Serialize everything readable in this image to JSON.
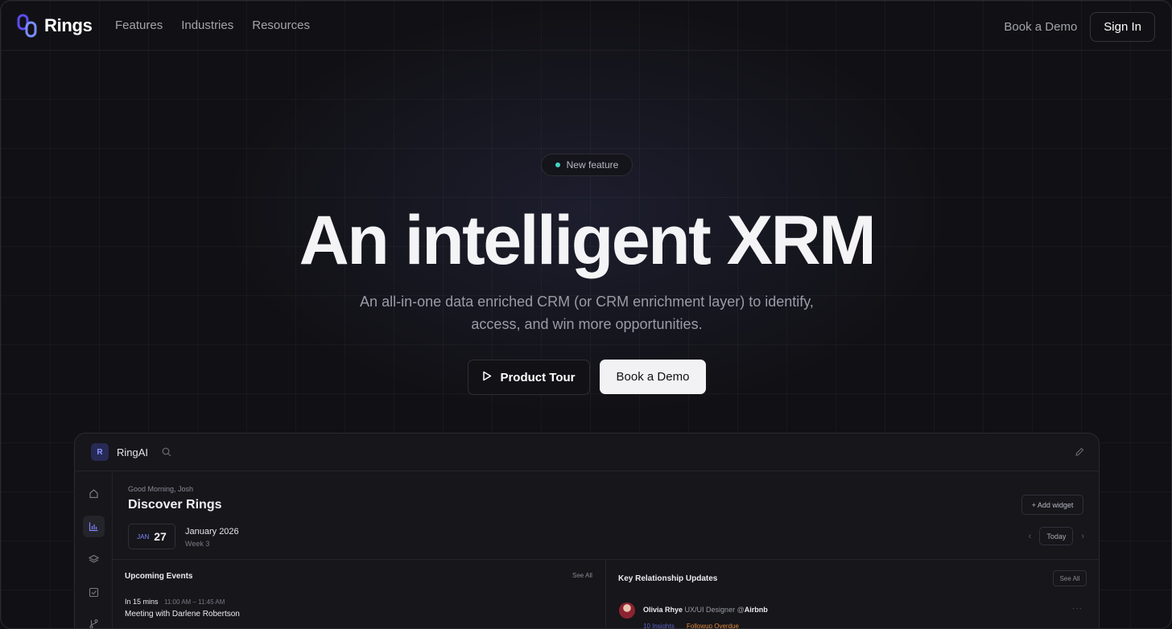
{
  "nav": {
    "brand": "Rings",
    "links": [
      "Features",
      "Industries",
      "Resources"
    ],
    "book_demo": "Book a Demo",
    "sign_in": "Sign In"
  },
  "hero": {
    "badge": "New feature",
    "title": "An intelligent XRM",
    "subtitle": "An all-in-one data enriched CRM (or CRM enrichment layer) to identify, access, and win more opportunities.",
    "tour_button": "Product Tour",
    "demo_button": "Book a Demo"
  },
  "app": {
    "avatar_letter": "R",
    "name": "RingAI",
    "greeting": "Good Morning, Josh",
    "title": "Discover Rings",
    "add_widget": "+ Add widget",
    "date_month": "JAN",
    "date_day": "27",
    "date_label": "January 2026",
    "date_week": "Week 3",
    "today": "Today",
    "events": {
      "title": "Upcoming Events",
      "see_all": "See All",
      "when": "In 15 mins",
      "time": "11:00 AM – 11:45 AM",
      "event_title": "Meeting with Darlene Robertson"
    },
    "relationships": {
      "title": "Key Relationship Updates",
      "see_all": "See All",
      "person_name": "Olivia Rhye",
      "person_role": "UX/UI Designer @",
      "person_company": "Airbnb",
      "insights": "10 Insights",
      "status": "Followup Overdue"
    }
  },
  "colors": {
    "accent_indigo": "#6b5cff",
    "badge_dot": "#3fd7c1",
    "overdue": "#e08a3a"
  }
}
